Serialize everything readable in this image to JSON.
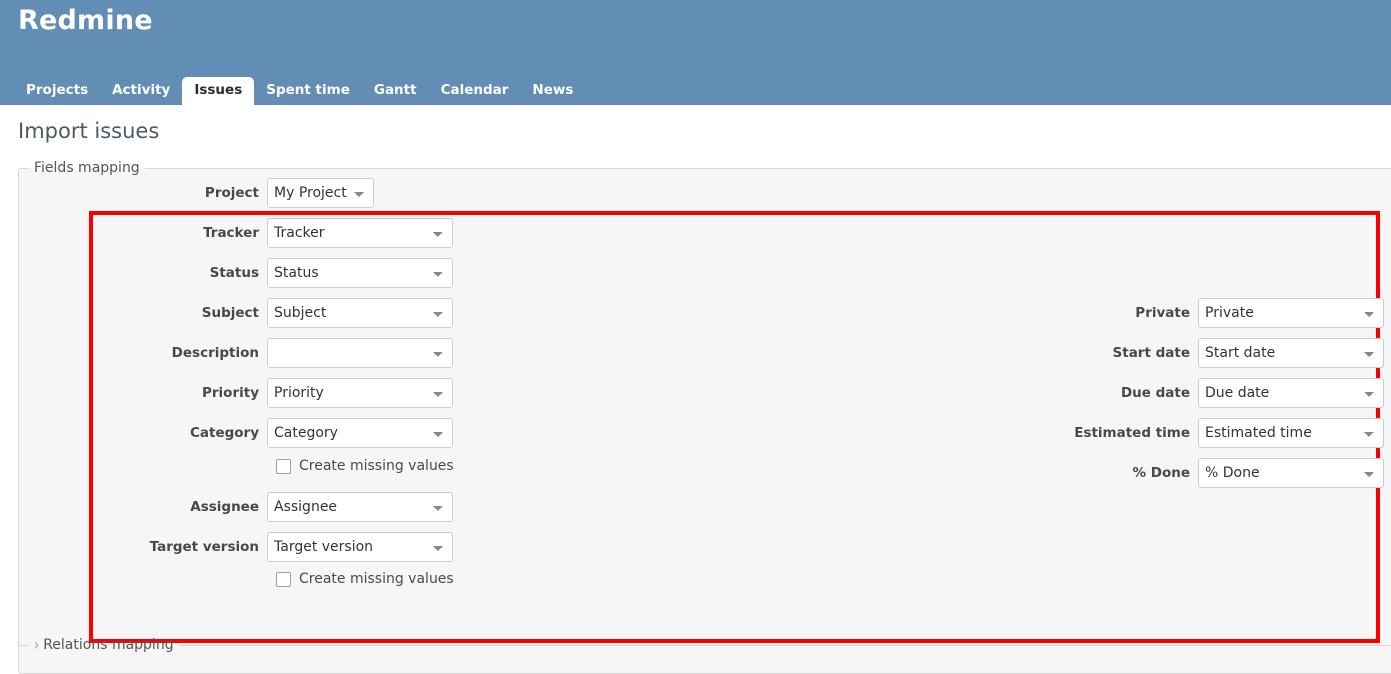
{
  "app": {
    "title": "Redmine"
  },
  "main_menu": [
    {
      "label": "Projects",
      "selected": false
    },
    {
      "label": "Activity",
      "selected": false
    },
    {
      "label": "Issues",
      "selected": true
    },
    {
      "label": "Spent time",
      "selected": false
    },
    {
      "label": "Gantt",
      "selected": false
    },
    {
      "label": "Calendar",
      "selected": false
    },
    {
      "label": "News",
      "selected": false
    }
  ],
  "page": {
    "title": "Import issues"
  },
  "fields_mapping": {
    "legend": "Fields mapping",
    "left_column": [
      {
        "label": "Project",
        "value": "My Project"
      },
      {
        "label": "Tracker",
        "value": "Tracker"
      },
      {
        "label": "Status",
        "value": "Status"
      },
      {
        "label": "Subject",
        "value": "Subject"
      },
      {
        "label": "Description",
        "value": ""
      },
      {
        "label": "Priority",
        "value": "Priority"
      },
      {
        "label": "Category",
        "value": "Category"
      },
      {
        "label": "Assignee",
        "value": "Assignee"
      },
      {
        "label": "Target version",
        "value": "Target version"
      }
    ],
    "right_column": [
      {
        "label": "Private",
        "value": "Private"
      },
      {
        "label": "Start date",
        "value": "Start date"
      },
      {
        "label": "Due date",
        "value": "Due date"
      },
      {
        "label": "Estimated time",
        "value": "Estimated time"
      },
      {
        "label": "% Done",
        "value": "% Done"
      }
    ],
    "checkboxes": [
      {
        "label": "Create missing values",
        "checked": false
      },
      {
        "label": "Create missing values",
        "checked": false
      }
    ]
  },
  "relations_mapping": {
    "legend": "Relations mapping",
    "arrow": "›",
    "expanded": false
  },
  "annotation": {
    "color": "#fb0000"
  },
  "colors": {
    "header_blue": "#628db4",
    "fieldset_bg": "#f6f6f6",
    "page_bg": "#ffffff",
    "label_text": "#484848",
    "title_text": "#4d5a66"
  }
}
